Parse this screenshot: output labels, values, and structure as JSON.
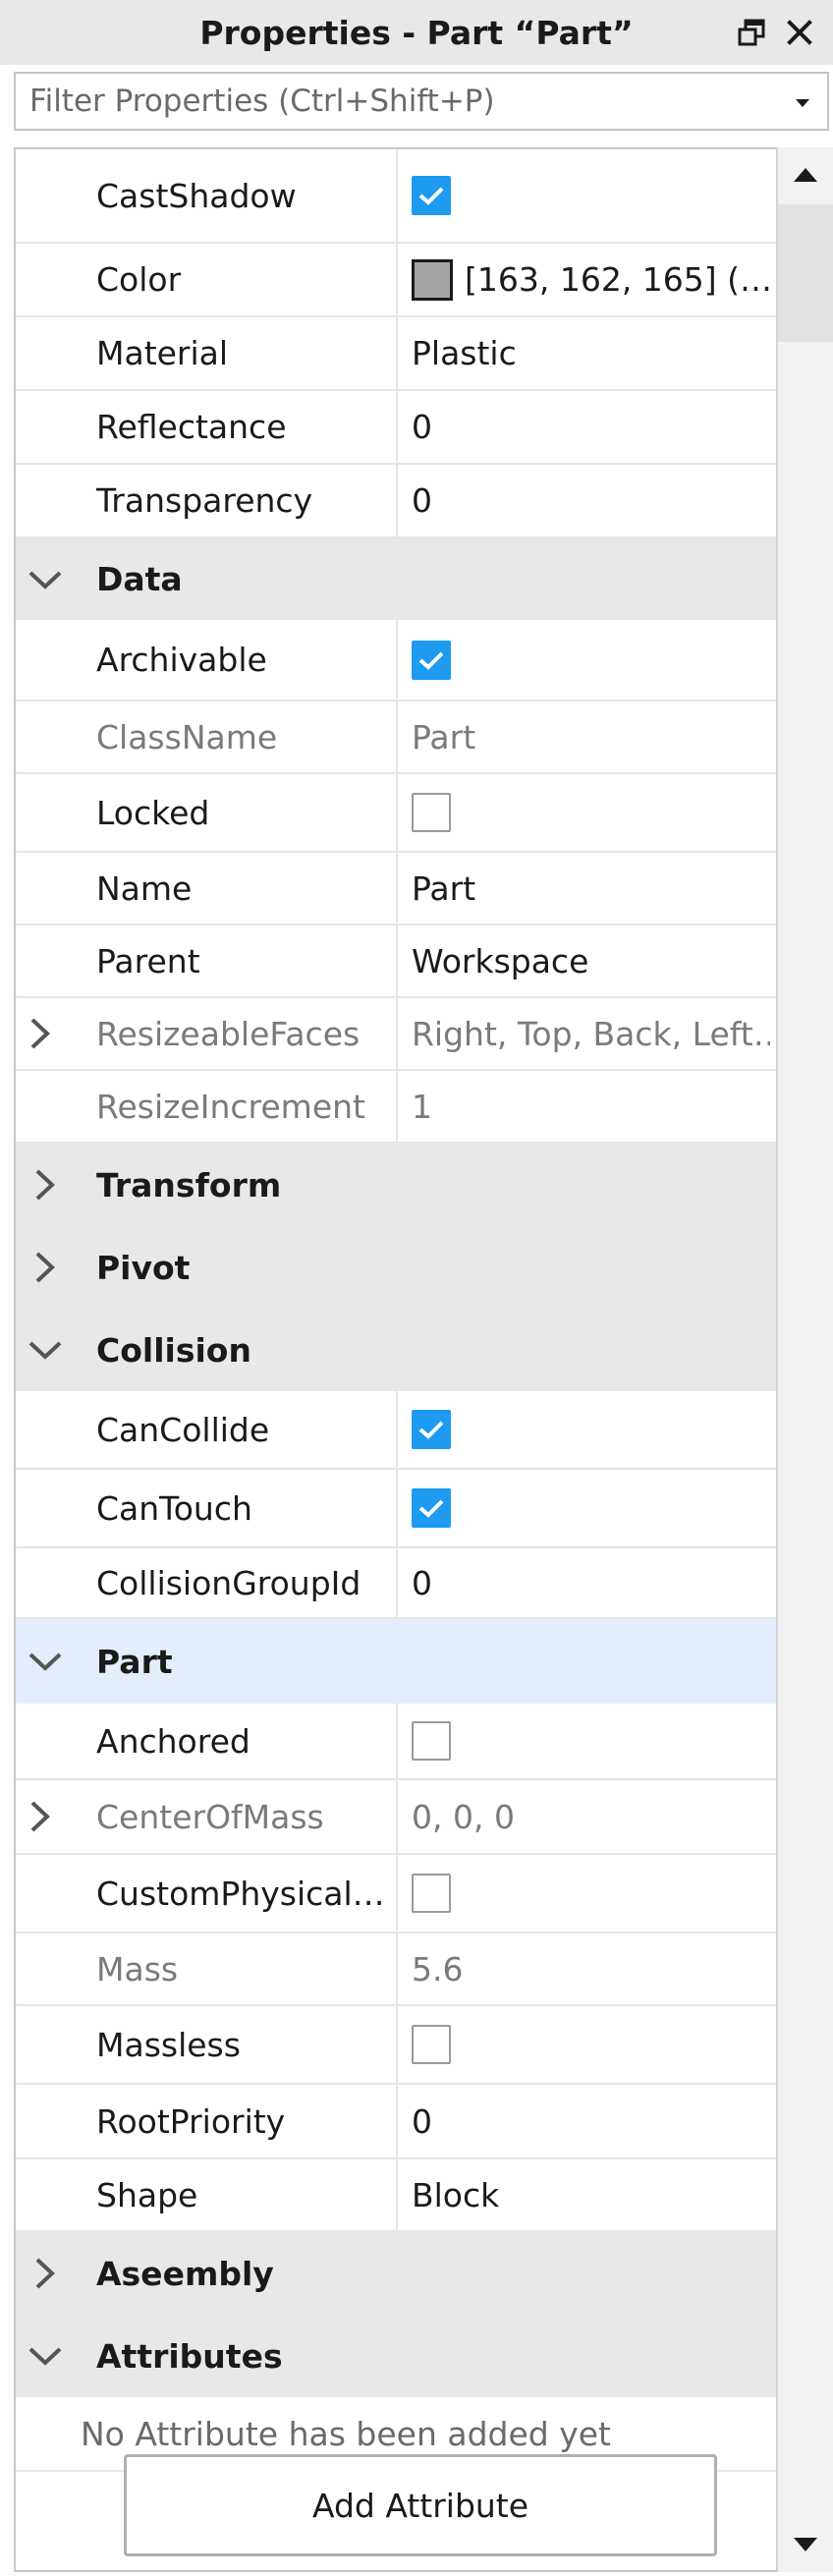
{
  "window": {
    "title": "Properties - Part “Part”"
  },
  "filter": {
    "placeholder": "Filter Properties (Ctrl+Shift+P)"
  },
  "properties": {
    "cast_shadow": {
      "label": "CastShadow",
      "checked": true
    },
    "color": {
      "label": "Color",
      "value": "[163, 162, 165] (…",
      "swatch": "#a3a2a5"
    },
    "material": {
      "label": "Material",
      "value": "Plastic"
    },
    "reflectance": {
      "label": "Reflectance",
      "value": "0"
    },
    "transparency": {
      "label": "Transparency",
      "value": "0"
    },
    "archivable": {
      "label": "Archivable",
      "checked": true
    },
    "class_name": {
      "label": "ClassName",
      "value": "Part"
    },
    "locked": {
      "label": "Locked",
      "checked": false
    },
    "name": {
      "label": "Name",
      "value": "Part"
    },
    "parent": {
      "label": "Parent",
      "value": "Workspace"
    },
    "resizeable_faces": {
      "label": "ResizeableFaces",
      "value": "Right, Top, Back, Left…"
    },
    "resize_increment": {
      "label": "ResizeIncrement",
      "value": "1"
    },
    "can_collide": {
      "label": "CanCollide",
      "checked": true
    },
    "can_touch": {
      "label": "CanTouch",
      "checked": true
    },
    "collision_group_id": {
      "label": "CollisionGroupId",
      "value": "0"
    },
    "anchored": {
      "label": "Anchored",
      "checked": false
    },
    "center_of_mass": {
      "label": "CenterOfMass",
      "value": "0, 0, 0"
    },
    "custom_physical": {
      "label": "CustomPhysical…",
      "checked": false
    },
    "mass": {
      "label": "Mass",
      "value": "5.6"
    },
    "massless": {
      "label": "Massless",
      "checked": false
    },
    "root_priority": {
      "label": "RootPriority",
      "value": "0"
    },
    "shape": {
      "label": "Shape",
      "value": "Block"
    }
  },
  "sections": {
    "data": {
      "label": "Data",
      "expanded": true
    },
    "transform": {
      "label": "Transform",
      "expanded": false
    },
    "pivot": {
      "label": "Pivot",
      "expanded": false
    },
    "collision": {
      "label": "Collision",
      "expanded": true
    },
    "part": {
      "label": "Part",
      "expanded": true,
      "selected": true
    },
    "assembly": {
      "label": "Aseembly",
      "expanded": false
    },
    "attributes": {
      "label": "Attributes",
      "expanded": true
    }
  },
  "attributes": {
    "empty_message": "No Attribute has been added yet",
    "add_button": "Add Attribute"
  },
  "colors": {
    "checkbox_checked": "#1e9bf0",
    "section_header": "#e8e8e8",
    "section_selected": "#e3edfb"
  },
  "icons": {
    "float": "float-window-icon",
    "close": "close-icon",
    "dropdown": "caret-down-icon",
    "expand": "chevron-right-icon",
    "collapse": "chevron-down-icon",
    "scroll_up": "arrow-up-icon",
    "scroll_down": "arrow-down-icon"
  }
}
